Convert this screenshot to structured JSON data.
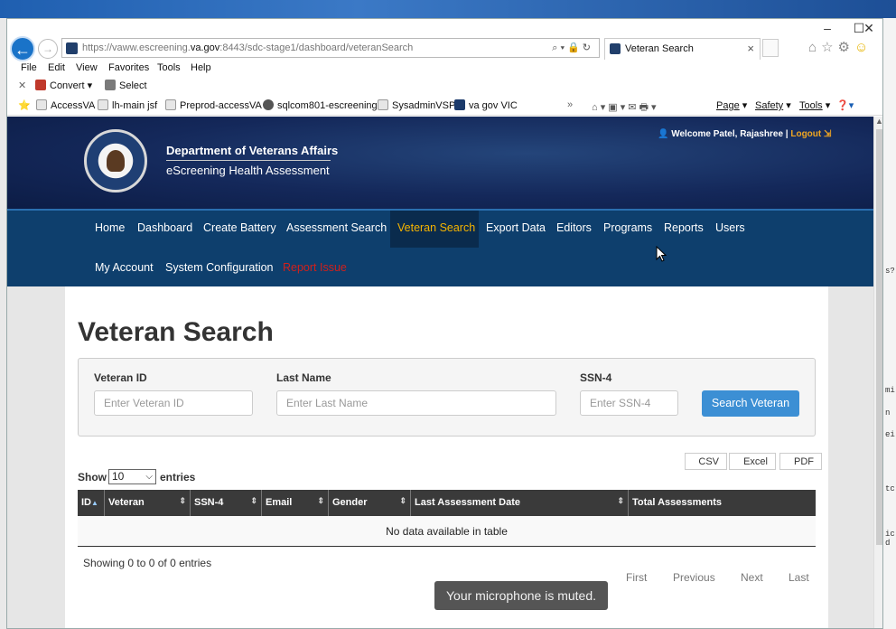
{
  "browser": {
    "url_host": "https://vaww.escreening.",
    "url_domain": "va.gov",
    "url_path": ":8443/sdc-stage1/dashboard/veteranSearch",
    "tab_title": "Veteran Search",
    "menu": [
      "File",
      "Edit",
      "View",
      "Favorites",
      "Tools",
      "Help"
    ],
    "commands": {
      "convert": "Convert",
      "select": "Select"
    },
    "favorites": [
      "AccessVA",
      "lh-main jsf",
      "Preprod-accessVA",
      "sqlcom801-escreening",
      "SysadminVSP",
      "va gov VIC"
    ],
    "toolbar": [
      "Page",
      "Safety",
      "Tools"
    ]
  },
  "header": {
    "department": "Department of Veterans Affairs",
    "subtitle": "eScreening Health Assessment",
    "welcome": "Welcome Patel, Rajashree |",
    "logout": "Logout"
  },
  "nav": {
    "row1": [
      "Home",
      "Dashboard",
      "Create Battery",
      "Assessment Search",
      "Veteran Search",
      "Export Data",
      "Editors",
      "Programs",
      "Reports",
      "Users"
    ],
    "row2": [
      "My Account",
      "System Configuration",
      "Report Issue"
    ],
    "active": "Veteran Search"
  },
  "main": {
    "title": "Veteran Search",
    "search": {
      "veteran_id_label": "Veteran ID",
      "veteran_id_placeholder": "Enter Veteran ID",
      "last_name_label": "Last Name",
      "last_name_placeholder": "Enter Last Name",
      "ssn_label": "SSN-4",
      "ssn_placeholder": "Enter SSN-4",
      "button": "Search Veteran"
    },
    "exports": [
      "CSV",
      "Excel",
      "PDF"
    ],
    "show_label": "Show",
    "page_size": "10",
    "entries_label": "entries",
    "columns": [
      "ID",
      "Veteran",
      "SSN-4",
      "Email",
      "Gender",
      "Last Assessment Date",
      "Total Assessments"
    ],
    "empty_message": "No data available in table",
    "info": "Showing 0 to 0 of 0 entries",
    "pagination": [
      "First",
      "Previous",
      "Next",
      "Last"
    ]
  },
  "notification": "Your microphone is muted."
}
